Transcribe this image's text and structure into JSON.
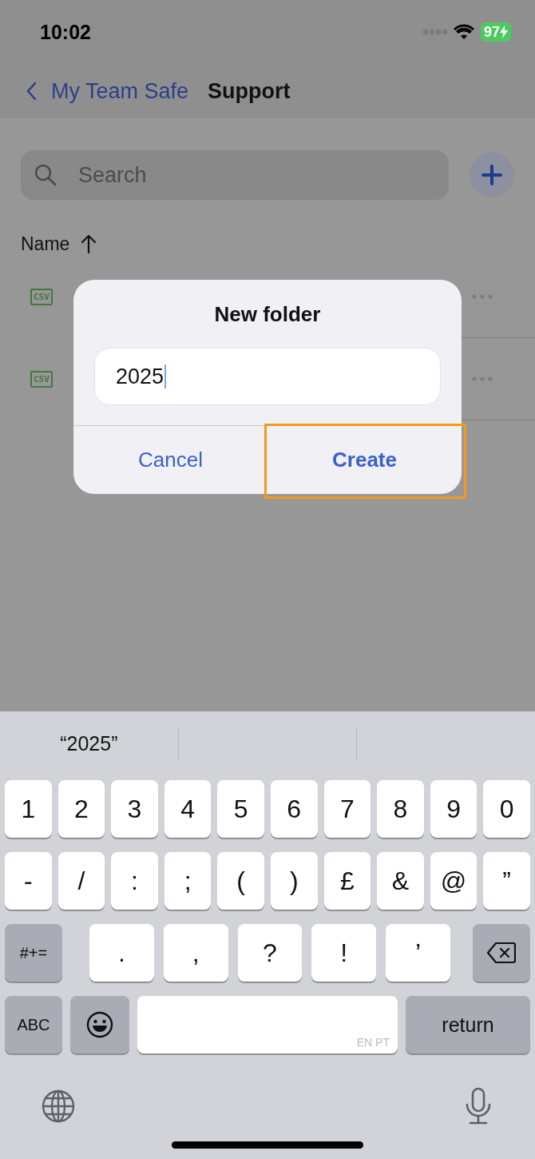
{
  "status_bar": {
    "time": "10:02",
    "battery": "97",
    "charging": true
  },
  "nav": {
    "back": "My Team Safe",
    "title": "Support"
  },
  "search": {
    "placeholder": "Search"
  },
  "sort": {
    "label": "Name",
    "ascending": true
  },
  "files": [
    {
      "icon_label": "CSV"
    },
    {
      "icon_label": "CSV"
    }
  ],
  "dialog": {
    "title": "New folder",
    "field": {
      "value": "2025"
    },
    "buttons": [
      {
        "label": "Cancel",
        "primary": false,
        "highlighted": false
      },
      {
        "label": "Create",
        "primary": true,
        "highlighted": true
      }
    ]
  },
  "keyboard": {
    "suggestions": [
      "“2025”"
    ],
    "number_keys": [
      {
        "kind": "char",
        "label": "1"
      },
      {
        "kind": "char",
        "label": "2"
      },
      {
        "kind": "char",
        "label": "3"
      },
      {
        "kind": "char",
        "label": "4"
      },
      {
        "kind": "char",
        "label": "5"
      },
      {
        "kind": "char",
        "label": "6"
      },
      {
        "kind": "char",
        "label": "7"
      },
      {
        "kind": "char",
        "label": "8"
      },
      {
        "kind": "char",
        "label": "9"
      },
      {
        "kind": "char",
        "label": "0"
      }
    ],
    "symbol_keys": [
      {
        "kind": "char",
        "label": "-"
      },
      {
        "kind": "char",
        "label": "/"
      },
      {
        "kind": "char",
        "label": ":"
      },
      {
        "kind": "char",
        "label": ";"
      },
      {
        "kind": "char",
        "label": "("
      },
      {
        "kind": "char",
        "label": ")"
      },
      {
        "kind": "char",
        "label": "£"
      },
      {
        "kind": "char",
        "label": "&"
      },
      {
        "kind": "char",
        "label": "@"
      },
      {
        "kind": "char",
        "label": "”"
      }
    ],
    "punctuation_keys": [
      {
        "kind": "function",
        "label": "#+="
      },
      {
        "kind": "char",
        "label": "."
      },
      {
        "kind": "char",
        "label": ","
      },
      {
        "kind": "char",
        "label": "?"
      },
      {
        "kind": "char",
        "label": "!"
      },
      {
        "kind": "char",
        "label": "’"
      },
      {
        "kind": "delete"
      }
    ],
    "bottom_keys": [
      {
        "kind": "function",
        "label": "ABC"
      },
      {
        "kind": "emoji"
      },
      {
        "kind": "space",
        "label": "EN PT"
      },
      {
        "kind": "return",
        "label": "return"
      }
    ]
  }
}
